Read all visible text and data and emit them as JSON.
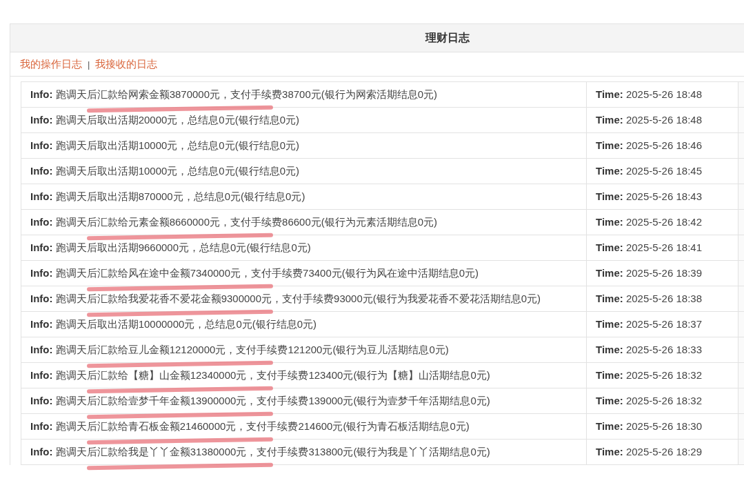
{
  "panel": {
    "title": "理财日志"
  },
  "links": [
    {
      "label": "我的操作日志"
    },
    {
      "label": "我接收的日志"
    }
  ],
  "link_separator": "|",
  "rows": [
    {
      "info_label": "Info:",
      "info": "跑调天后汇款给网索金额3870000元，支付手续费38700元(银行为网索活期结息0元)",
      "time_label": "Time:",
      "time": "2025-5-26 18:48",
      "marked": true
    },
    {
      "info_label": "Info:",
      "info": "跑调天后取出活期20000元，总结息0元(银行结息0元)",
      "time_label": "Time:",
      "time": "2025-5-26 18:48",
      "marked": false
    },
    {
      "info_label": "Info:",
      "info": "跑调天后取出活期10000元，总结息0元(银行结息0元)",
      "time_label": "Time:",
      "time": "2025-5-26 18:46",
      "marked": false
    },
    {
      "info_label": "Info:",
      "info": "跑调天后取出活期10000元，总结息0元(银行结息0元)",
      "time_label": "Time:",
      "time": "2025-5-26 18:45",
      "marked": false
    },
    {
      "info_label": "Info:",
      "info": "跑调天后取出活期870000元，总结息0元(银行结息0元)",
      "time_label": "Time:",
      "time": "2025-5-26 18:43",
      "marked": false
    },
    {
      "info_label": "Info:",
      "info": "跑调天后汇款给元素金额8660000元，支付手续费86600元(银行为元素活期结息0元)",
      "time_label": "Time:",
      "time": "2025-5-26 18:42",
      "marked": true
    },
    {
      "info_label": "Info:",
      "info": "跑调天后取出活期9660000元，总结息0元(银行结息0元)",
      "time_label": "Time:",
      "time": "2025-5-26 18:41",
      "marked": false
    },
    {
      "info_label": "Info:",
      "info": "跑调天后汇款给风在途中金额7340000元，支付手续费73400元(银行为风在途中活期结息0元)",
      "time_label": "Time:",
      "time": "2025-5-26 18:39",
      "marked": true
    },
    {
      "info_label": "Info:",
      "info": "跑调天后汇款给我爱花香不爱花金额9300000元，支付手续费93000元(银行为我爱花香不爱花活期结息0元)",
      "time_label": "Time:",
      "time": "2025-5-26 18:38",
      "marked": true
    },
    {
      "info_label": "Info:",
      "info": "跑调天后取出活期10000000元，总结息0元(银行结息0元)",
      "time_label": "Time:",
      "time": "2025-5-26 18:37",
      "marked": false
    },
    {
      "info_label": "Info:",
      "info": "跑调天后汇款给豆儿金额12120000元，支付手续费121200元(银行为豆儿活期结息0元)",
      "time_label": "Time:",
      "time": "2025-5-26 18:33",
      "marked": true
    },
    {
      "info_label": "Info:",
      "info": "跑调天后汇款给【糖】山金额12340000元，支付手续费123400元(银行为【糖】山活期结息0元)",
      "time_label": "Time:",
      "time": "2025-5-26 18:32",
      "marked": true
    },
    {
      "info_label": "Info:",
      "info": "跑调天后汇款给壹梦千年金额13900000元，支付手续费139000元(银行为壹梦千年活期结息0元)",
      "time_label": "Time:",
      "time": "2025-5-26 18:32",
      "marked": true
    },
    {
      "info_label": "Info:",
      "info": "跑调天后汇款给青石板金额21460000元，支付手续费214600元(银行为青石板活期结息0元)",
      "time_label": "Time:",
      "time": "2025-5-26 18:30",
      "marked": true
    },
    {
      "info_label": "Info:",
      "info": "跑调天后汇款给我是丫丫金额31380000元，支付手续费313800元(银行为我是丫丫活期结息0元)",
      "time_label": "Time:",
      "time": "2025-5-26 18:29",
      "marked": true
    }
  ]
}
